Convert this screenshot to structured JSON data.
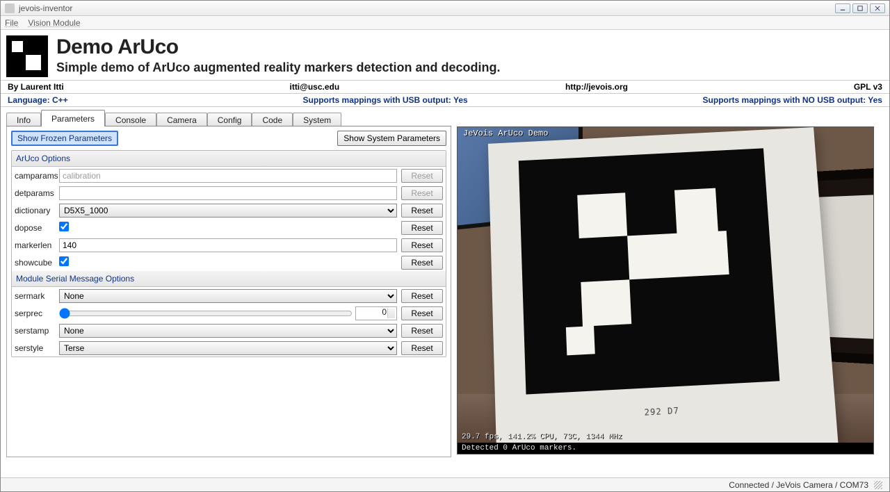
{
  "window": {
    "title": "jevois-inventor"
  },
  "menu": {
    "file": "File",
    "vision": "Vision Module"
  },
  "header": {
    "title": "Demo ArUco",
    "subtitle": "Simple demo of ArUco augmented reality markers detection and decoding."
  },
  "info1": {
    "author": "By Laurent Itti",
    "email": "itti@usc.edu",
    "url": "http://jevois.org",
    "license": "GPL v3"
  },
  "info2": {
    "lang": "Language: C++",
    "usb": "Supports mappings with USB output: Yes",
    "nousb": "Supports mappings with NO USB output: Yes"
  },
  "tabs": {
    "info": "Info",
    "params": "Parameters",
    "console": "Console",
    "camera": "Camera",
    "config": "Config",
    "code": "Code",
    "system": "System"
  },
  "buttons": {
    "showFrozen": "Show Frozen Parameters",
    "showSystem": "Show System Parameters",
    "reset": "Reset"
  },
  "groups": {
    "aruco": "ArUco Options",
    "serial": "Module Serial Message Options"
  },
  "params": {
    "camparams": {
      "label": "camparams",
      "placeholder": "calibration",
      "value": ""
    },
    "detparams": {
      "label": "detparams",
      "value": ""
    },
    "dictionary": {
      "label": "dictionary",
      "value": "D5X5_1000"
    },
    "dopose": {
      "label": "dopose",
      "checked": true
    },
    "markerlen": {
      "label": "markerlen",
      "value": "140"
    },
    "showcube": {
      "label": "showcube",
      "checked": true
    },
    "sermark": {
      "label": "sermark",
      "value": "None"
    },
    "serprec": {
      "label": "serprec",
      "value": "0"
    },
    "serstamp": {
      "label": "serstamp",
      "value": "None"
    },
    "serstyle": {
      "label": "serstyle",
      "value": "Terse"
    }
  },
  "camera": {
    "overlayTitle": "JeVois ArUco Demo",
    "boardLabel": "292 D7",
    "stats": "29.7 fps, 141.2% CPU, 73C, 1344 MHz",
    "detected": "Detected 0 ArUco markers."
  },
  "status": {
    "text": "Connected / JeVois Camera / COM73"
  }
}
